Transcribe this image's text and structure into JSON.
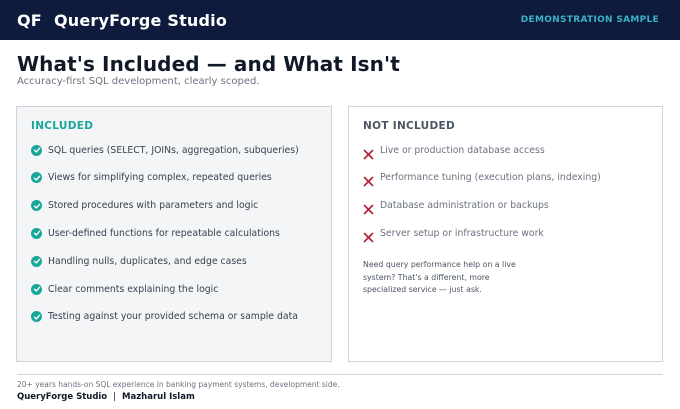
{
  "header": {
    "logo_mark": "QF",
    "app_name": "QueryForge Studio",
    "badge": "DEMONSTRATION SAMPLE"
  },
  "page": {
    "title": "What's Included — and What Isn't",
    "subtitle": "Accuracy-first SQL development, clearly scoped."
  },
  "included": {
    "heading": "INCLUDED",
    "icon": "check-circle-icon",
    "accent_color": "#1aa79a",
    "items": [
      "SQL queries (SELECT, JOINs, aggregation, subqueries)",
      "Views for simplifying complex, repeated queries",
      "Stored procedures with parameters and logic",
      "User-defined functions for repeatable calculations",
      "Handling nulls, duplicates, and edge cases",
      "Clear comments explaining the logic",
      "Testing against your provided schema or sample data"
    ]
  },
  "not_included": {
    "heading": "NOT INCLUDED",
    "icon": "x-mark-icon",
    "accent_color": "#b3213a",
    "items": [
      "Live or production database access",
      "Performance tuning (execution plans, indexing)",
      "Database administration or backups",
      "Server setup or infrastructure work"
    ],
    "note": "Need query performance help on a live system? That's a different, more specialized service — just ask."
  },
  "footer": {
    "experience": "20+ years hands-on SQL experience in banking payment systems, development side.",
    "brand": "QueryForge Studio",
    "separator": "|",
    "author": "Mazharul Islam"
  }
}
